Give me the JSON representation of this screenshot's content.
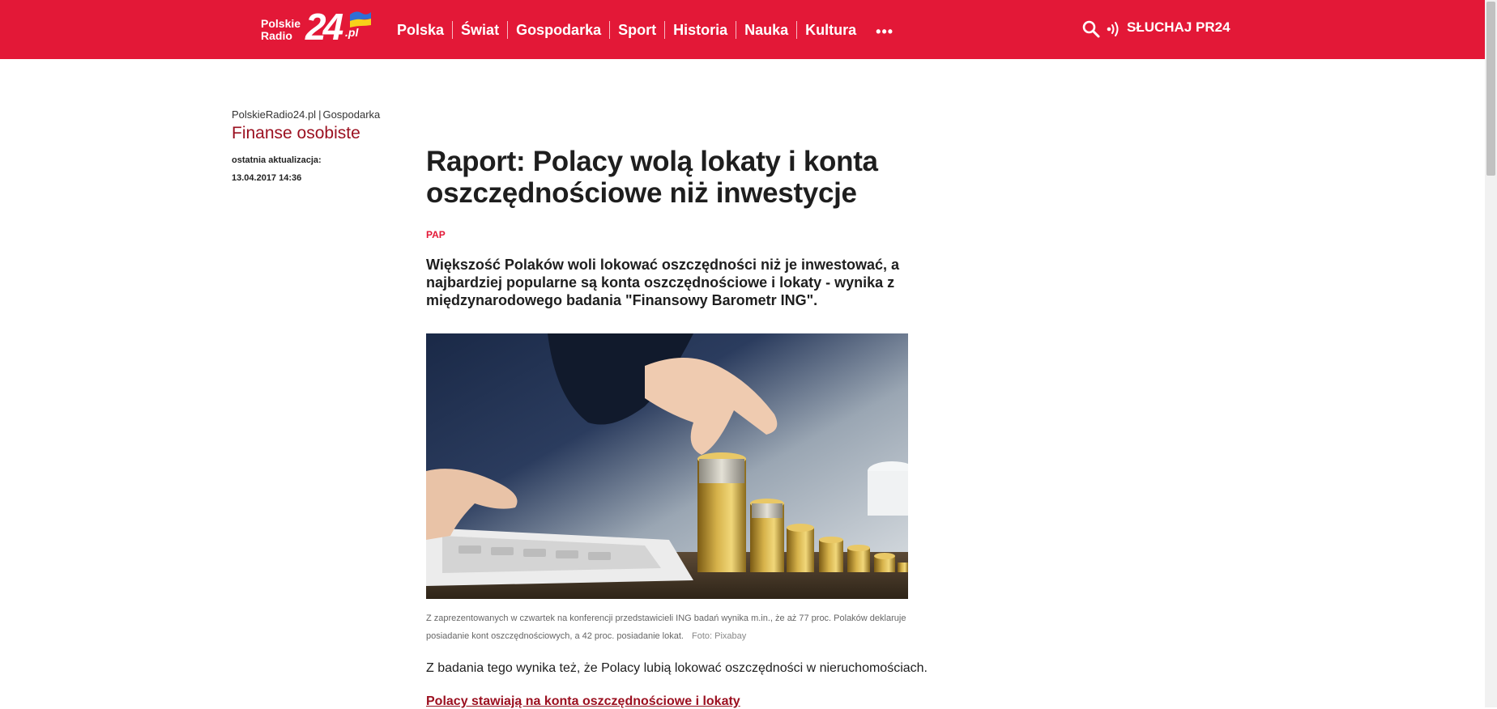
{
  "header": {
    "logo": {
      "line1": "Polskie",
      "line2": "Radio",
      "big": "24",
      "suffix": ".pl"
    },
    "nav": [
      {
        "label": "Polska"
      },
      {
        "label": "Świat"
      },
      {
        "label": "Gospodarka"
      },
      {
        "label": "Sport"
      },
      {
        "label": "Historia"
      },
      {
        "label": "Nauka"
      },
      {
        "label": "Kultura"
      }
    ],
    "more_label": "•••",
    "listen_label": "SŁUCHAJ PR24",
    "colors": {
      "brand": "#e31837",
      "section": "#9b1020"
    },
    "icons": [
      "search-icon",
      "listen-icon",
      "ukraine-flag-icon"
    ]
  },
  "meta": {
    "breadcrumb": [
      "PolskieRadio24.pl",
      "Gospodarka"
    ],
    "breadcrumb_sep": "|",
    "section": "Finanse osobiste",
    "update_label": "ostatnia aktualizacja:",
    "update_date": "13.04.2017 14:36"
  },
  "article": {
    "title": "Raport: Polacy wolą lokaty i konta oszczędnościowe niż inwestycje",
    "source": "PAP",
    "lead": "Większość Polaków woli lokować oszczędności niż je inwestować, a najbardziej popularne są konta oszczędnościowe i lokaty - wynika z międzynarodowego badania \"Finansowy Barometr ING\".",
    "caption": "Z zaprezentowanych w czwartek na konferencji przedstawicieli ING badań wynika m.in., że aż 77 proc. Polaków deklaruje posiadanie kont oszczędnościowych, a 42 proc. posiadanie lokat.",
    "photo_credit": "Foto: Pixabay",
    "paragraph": "Z badania tego wynika też, że Polacy lubią lokować oszczędności w nieruchomościach.",
    "subheading": "Polacy stawiają na konta oszczędnościowe i lokaty"
  }
}
